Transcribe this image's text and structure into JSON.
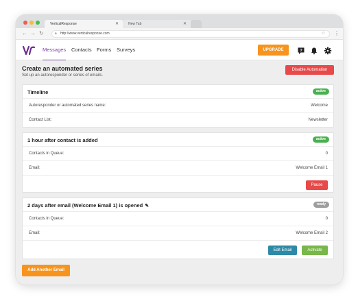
{
  "browser": {
    "tabs": [
      {
        "title": "VerticalResponse"
      },
      {
        "title": "New Tab"
      }
    ],
    "url": "http://www.verticalresponse.com"
  },
  "header": {
    "nav": [
      "Messages",
      "Contacts",
      "Forms",
      "Surveys"
    ],
    "upgrade_label": "UPGRADE",
    "accent": "#7b3f9e"
  },
  "page": {
    "title": "Create an automated series",
    "subtitle": "Set up an autoresponder or series of emails.",
    "disable_label": "Disable Automation"
  },
  "timeline": {
    "title": "Timeline",
    "status": "active",
    "rows": [
      {
        "label": "Autoresponder or automated series name:",
        "value": "Welcome"
      },
      {
        "label": "Contact List:",
        "value": "Newsletter"
      }
    ]
  },
  "step1": {
    "title": "1 hour after contact is added",
    "status": "active",
    "rows": [
      {
        "label": "Contacts in Queue:",
        "value": "0"
      },
      {
        "label": "Email:",
        "value": "Welcome Email 1"
      }
    ],
    "pause_label": "Pause"
  },
  "step2": {
    "title": "2 days after email (Welcome Email 1) is opened",
    "status": "ready",
    "rows": [
      {
        "label": "Contacts in Queue:",
        "value": "0"
      },
      {
        "label": "Email:",
        "value": "Welcome Email 2"
      }
    ],
    "edit_label": "Edit Email",
    "activate_label": "Activate"
  },
  "footer": {
    "add_label": "Add Another Email"
  },
  "icons": [
    "back-icon",
    "forward-icon",
    "reload-icon",
    "lock-icon",
    "star-icon",
    "more-icon",
    "help-icon",
    "bell-icon",
    "gear-icon",
    "pencil-icon"
  ]
}
